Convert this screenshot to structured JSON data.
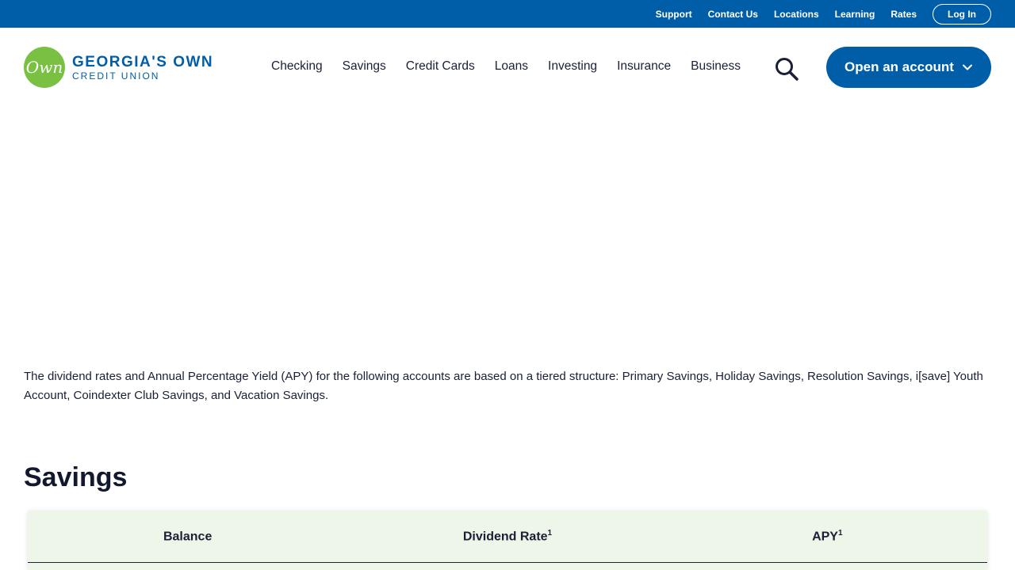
{
  "utility_nav": {
    "links": [
      "Support",
      "Contact Us",
      "Locations",
      "Learning",
      "Rates"
    ],
    "login_label": "Log In"
  },
  "brand": {
    "mark": "Own",
    "name_line1": "GEORGIA'S OWN",
    "name_line2": "CREDIT UNION",
    "colors": {
      "primary": "#005da8",
      "accent": "#7ac143"
    }
  },
  "main_nav": {
    "items": [
      "Checking",
      "Savings",
      "Credit Cards",
      "Loans",
      "Investing",
      "Insurance",
      "Business"
    ],
    "search_icon": "search-icon",
    "cta_label": "Open an account",
    "cta_icon": "chevron-down-icon"
  },
  "content": {
    "intro": "The dividend rates and Annual Percentage Yield (APY) for the following accounts are based on a tiered structure: Primary Savings, Holiday Savings, Resolution Savings, i[save] Youth Account, Coindexter Club Savings, and Vacation Savings.",
    "section_title": "Savings",
    "table": {
      "headers": [
        {
          "label": "Balance",
          "note": ""
        },
        {
          "label": "Dividend Rate",
          "note": "1"
        },
        {
          "label": "APY",
          "note": "1"
        }
      ]
    }
  }
}
